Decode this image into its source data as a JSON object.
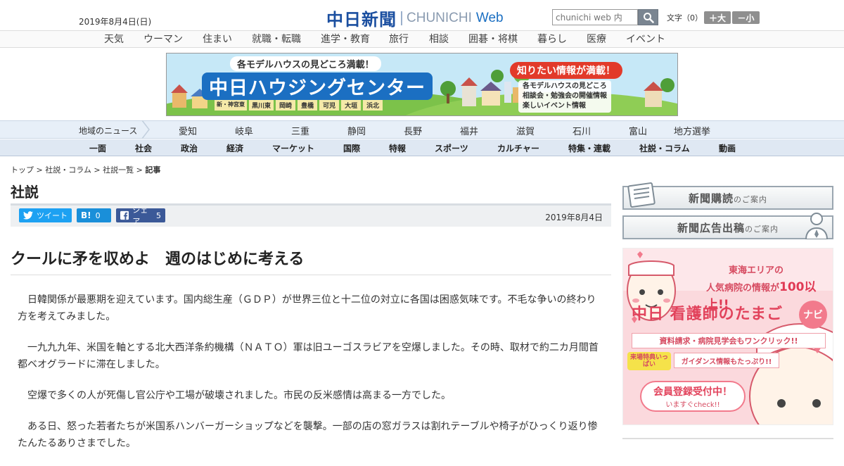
{
  "header": {
    "date": "2019年8月4日(日)",
    "logo_jp": "中日新聞",
    "logo_en": "CHUNICHI",
    "logo_web": "Web",
    "search_placeholder": "chunichi web 内",
    "font_size_label": "文字（0）",
    "font_bigger": "＋大",
    "font_smaller": "－小"
  },
  "top_nav": [
    "天気",
    "ウーマン",
    "住まい",
    "就職・転職",
    "進学・教育",
    "旅行",
    "相談",
    "囲碁・将棋",
    "暮らし",
    "医療",
    "イベント"
  ],
  "banner": {
    "headline": "各モデルハウスの見どころ満載！",
    "title": "中日ハウジングセンター",
    "locations": [
      "新・神宮東",
      "黒川東",
      "岡崎",
      "豊橋",
      "可児",
      "大垣",
      "浜北"
    ],
    "callout": "知りたい情報が満載！",
    "features": [
      "各モデルハウスの見どころ",
      "相談会・勉強会の開催情報",
      "楽しいイベント情報"
    ]
  },
  "region_nav": {
    "label": "地域のニュース",
    "items": [
      "愛知",
      "岐阜",
      "三重",
      "静岡",
      "長野",
      "福井",
      "滋賀",
      "石川",
      "富山",
      "地方選挙"
    ]
  },
  "main_nav": [
    "一面",
    "社会",
    "政治",
    "経済",
    "マーケット",
    "国際",
    "特報",
    "スポーツ",
    "カルチャー",
    "特集・連載",
    "社説・コラム",
    "動画"
  ],
  "breadcrumb": {
    "items": [
      "トップ",
      "社説・コラム",
      "社説一覧"
    ],
    "current": "記事",
    "sep": ">"
  },
  "section_title": "社説",
  "share": {
    "tweet": "ツイート",
    "hatena_label": "B!",
    "hatena_count": "0",
    "fb_label": "シェア",
    "fb_count": "5"
  },
  "article": {
    "date": "2019年8月4日",
    "headline": "クールに矛を収めよ　週のはじめに考える",
    "paragraphs": [
      "　日韓関係が最悪期を迎えています。国内総生産（ＧＤＰ）が世界三位と十二位の対立に各国は困惑気味です。不毛な争いの終わり方を考えてみました。",
      "　一九九九年、米国を軸とする北大西洋条約機構（ＮＡＴＯ）軍は旧ユーゴスラビアを空爆しました。その時、取材で約二カ月間首都ベオグラードに滞在しました。",
      "　空爆で多くの人が死傷し官公庁や工場が破壊されました。市民の反米感情は高まる一方でした。",
      "　ある日、怒った若者たちが米国系ハンバーガーショップなどを襲撃。一部の店の窓ガラスは割れテーブルや椅子がひっくり返り惨たんたるありさまでした。"
    ]
  },
  "sidebar": {
    "subscribe": {
      "main": "新聞購読",
      "small": "のご案内"
    },
    "ads": {
      "main": "新聞広告出稿",
      "small": "のご案内"
    },
    "nurse_banner": {
      "line1": "東海エリアの",
      "line2": "人気病院の情報が",
      "line2_num": "100以上!!",
      "title": "中日 看護師のたまご",
      "navi": "ナビ",
      "band1": "資料請求・病院見学会もワンクリック!!",
      "badge": "来場特典いっぱい",
      "band2": "ガイダンス情報もたっぷり!!",
      "cta": "会員登録受付中！",
      "cta_sub": "いますぐcheck!!"
    }
  },
  "colors": {
    "brand": "#1b4fa0",
    "twitter": "#1da1f2",
    "hatena": "#1a8fd9",
    "facebook": "#3b5998",
    "nurse_pink": "#f27a8c"
  }
}
